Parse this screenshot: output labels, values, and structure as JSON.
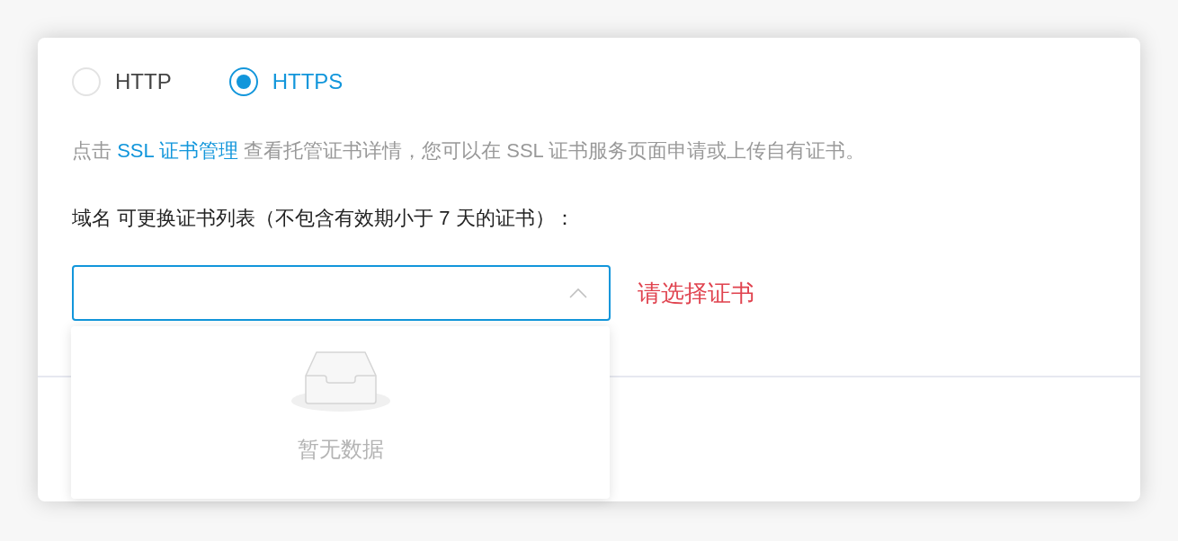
{
  "protocol_options": [
    {
      "label": "HTTP",
      "selected": false
    },
    {
      "label": "HTTPS",
      "selected": true
    }
  ],
  "description": {
    "before": "点击",
    "link": "SSL 证书管理",
    "after": "查看托管证书详情，您可以在 SSL 证书服务页面申请或上传自有证书。"
  },
  "field_label": "域名 可更换证书列表（不包含有效期小于 7 天的证书）：",
  "certificate_select": {
    "expanded": true,
    "error": "请选择证书",
    "empty_text": "暂无数据"
  }
}
